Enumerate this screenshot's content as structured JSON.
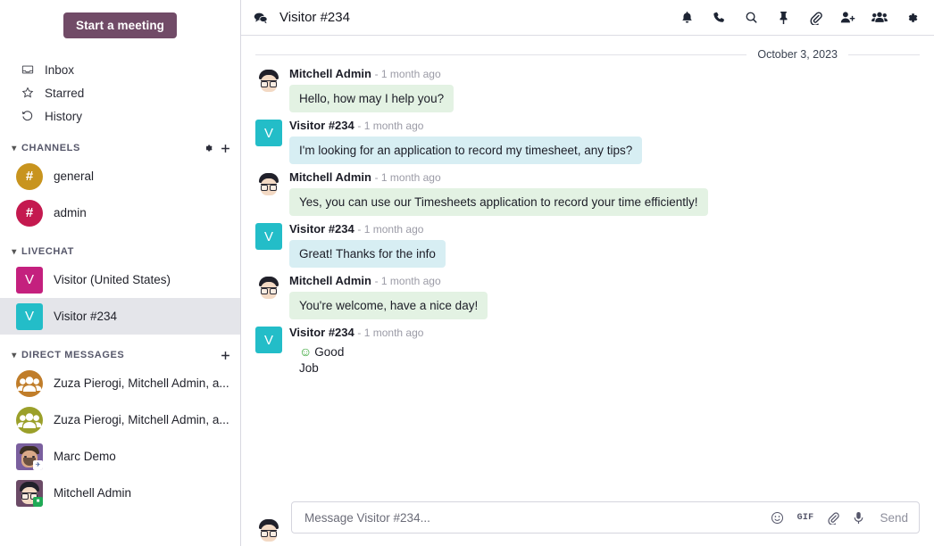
{
  "sidebar": {
    "start_meeting_label": "Start a meeting",
    "quick_links": [
      {
        "label": "Inbox",
        "icon": "inbox-icon"
      },
      {
        "label": "Starred",
        "icon": "star-icon"
      },
      {
        "label": "History",
        "icon": "history-icon"
      }
    ],
    "sections": [
      {
        "title": "CHANNELS",
        "actions": [
          "gear-icon",
          "plus-icon"
        ],
        "items": [
          {
            "label": "general",
            "avatar_text": "#",
            "avatar_color": "#c8941e",
            "shape": "circle"
          },
          {
            "label": "admin",
            "avatar_text": "#",
            "avatar_color": "#c4194f",
            "shape": "circle"
          }
        ]
      },
      {
        "title": "LIVECHAT",
        "actions": [],
        "items": [
          {
            "label": "Visitor (United States)",
            "avatar_text": "V",
            "avatar_color": "#c4207e",
            "shape": "square",
            "active": false
          },
          {
            "label": "Visitor #234",
            "avatar_text": "V",
            "avatar_color": "#23bdc8",
            "shape": "square",
            "active": true
          }
        ]
      },
      {
        "title": "DIRECT MESSAGES",
        "actions": [
          "plus-icon"
        ],
        "items": [
          {
            "label": "Zuza Pierogi, Mitchell Admin, a...",
            "avatar_kind": "group",
            "avatar_color": "#c07d2a"
          },
          {
            "label": "Zuza Pierogi, Mitchell Admin, a...",
            "avatar_kind": "group",
            "avatar_color": "#9ba02a"
          },
          {
            "label": "Marc Demo",
            "avatar_kind": "face-marc",
            "avatar_color": "#7a5f9e"
          },
          {
            "label": "Mitchell Admin",
            "avatar_kind": "face-mitchell",
            "avatar_color": "#6b4a66"
          }
        ]
      }
    ]
  },
  "header": {
    "icon": "comments-icon",
    "title": "Visitor #234",
    "actions": [
      "bell-icon",
      "phone-icon",
      "search-icon",
      "pin-icon",
      "paperclip-icon",
      "add-user-icon",
      "group-icon",
      "gear-icon"
    ]
  },
  "thread": {
    "date_divider": "October 3, 2023",
    "messages": [
      {
        "author": "Mitchell Admin",
        "time": "- 1 month ago",
        "text": "Hello, how may I help you?",
        "style": "green",
        "avatar_kind": "face-mitchell"
      },
      {
        "author": "Visitor #234",
        "time": "- 1 month ago",
        "text": "I'm looking for an application to record my timesheet, any tips?",
        "style": "blue",
        "avatar_kind": "letter",
        "avatar_text": "V",
        "avatar_color": "#23bdc8"
      },
      {
        "author": "Mitchell Admin",
        "time": "- 1 month ago",
        "text": "Yes, you can use our Timesheets application to record your time efficiently!",
        "style": "green",
        "avatar_kind": "face-mitchell"
      },
      {
        "author": "Visitor #234",
        "time": "- 1 month ago",
        "text": "Great! Thanks for the info",
        "style": "blue",
        "avatar_kind": "letter",
        "avatar_text": "V",
        "avatar_color": "#23bdc8"
      },
      {
        "author": "Mitchell Admin",
        "time": "- 1 month ago",
        "text": "You're welcome, have a nice day!",
        "style": "green",
        "avatar_kind": "face-mitchell"
      },
      {
        "author": "Visitor #234",
        "time": "- 1 month ago",
        "text": "Good",
        "text_line2": "Job",
        "emoji": "☺",
        "style": "plain",
        "avatar_kind": "letter",
        "avatar_text": "V",
        "avatar_color": "#23bdc8"
      }
    ]
  },
  "composer": {
    "placeholder": "Message Visitor #234...",
    "value": "",
    "gif_label": "GIF",
    "send_label": "Send",
    "tools": [
      "emoji-icon",
      "gif-icon",
      "paperclip-icon",
      "microphone-icon"
    ]
  },
  "colors": {
    "brand_purple": "#714B67",
    "bubble_green": "#e3f2e3",
    "bubble_blue": "#d7eef3",
    "active_row": "#e4e5ea"
  }
}
